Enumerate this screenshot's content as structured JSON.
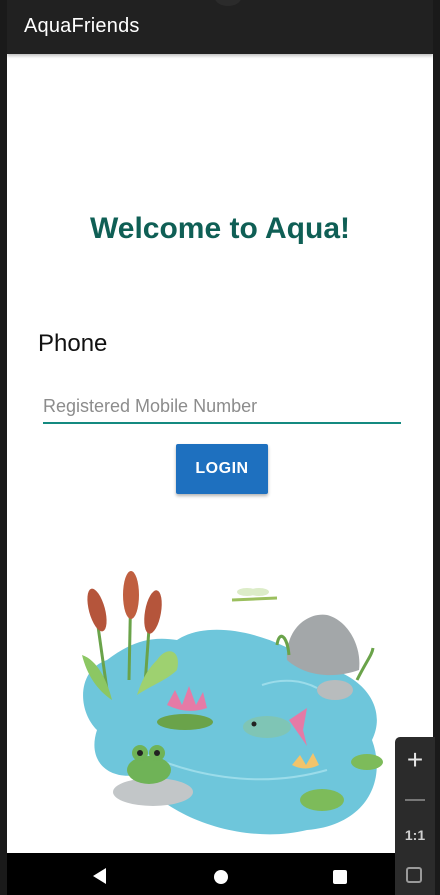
{
  "app_bar": {
    "title": "AquaFriends"
  },
  "welcome": {
    "heading": "Welcome to Aqua!"
  },
  "form": {
    "phone_label": "Phone",
    "phone_placeholder": "Registered Mobile Number",
    "phone_value": "",
    "login_label": "LOGIN"
  },
  "illustration": {
    "name": "pond-illustration"
  },
  "nav": {
    "back": "back-icon",
    "home": "home-icon",
    "recents": "recents-icon"
  },
  "zoom_controls": {
    "zoom_in": "+",
    "zoom_out": "−",
    "actual_size": "1:1",
    "fit": "fit-screen-icon"
  },
  "colors": {
    "app_bar": "#212121",
    "welcome_text": "#0f5f55",
    "input_underline": "#148a80",
    "login_button": "#1e70bf"
  }
}
